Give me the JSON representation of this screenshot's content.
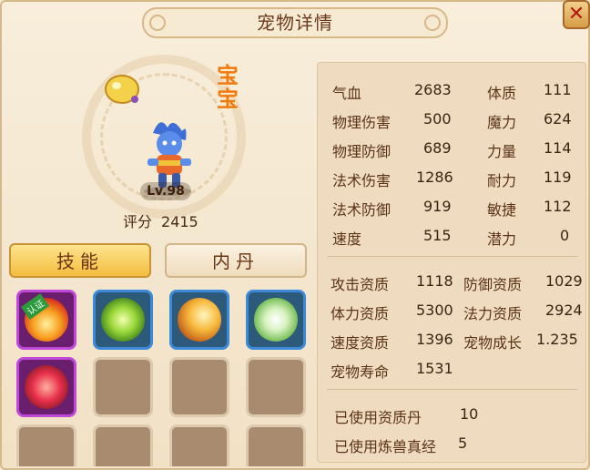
{
  "window": {
    "title": "宠物详情",
    "close_label": "✕"
  },
  "pet": {
    "tag": "宝宝",
    "level": "Lv.98",
    "score_label": "评分",
    "score_value": "2415"
  },
  "tabs": [
    {
      "label": "技能"
    },
    {
      "label": "内丹"
    }
  ],
  "skills": {
    "certified_badge": "认证"
  },
  "attributes": [
    {
      "label": "气血",
      "value": "2683"
    },
    {
      "label": "物理伤害",
      "value": "500"
    },
    {
      "label": "物理防御",
      "value": "689"
    },
    {
      "label": "法术伤害",
      "value": "1286"
    },
    {
      "label": "法术防御",
      "value": "919"
    },
    {
      "label": "速度",
      "value": "515"
    }
  ],
  "base_stats": [
    {
      "label": "体质",
      "value": "111"
    },
    {
      "label": "魔力",
      "value": "624"
    },
    {
      "label": "力量",
      "value": "114"
    },
    {
      "label": "耐力",
      "value": "119"
    },
    {
      "label": "敏捷",
      "value": "112"
    },
    {
      "label": "潜力",
      "value": "0"
    }
  ],
  "aptitudes": [
    {
      "label": "攻击资质",
      "value": "1118"
    },
    {
      "label": "防御资质",
      "value": "1029"
    },
    {
      "label": "体力资质",
      "value": "5300"
    },
    {
      "label": "法力资质",
      "value": "2924"
    },
    {
      "label": "速度资质",
      "value": "1396"
    },
    {
      "label": "宠物成长",
      "value": "1.235"
    },
    {
      "label": "宠物寿命",
      "value": "1531"
    }
  ],
  "usage": [
    {
      "label": "已使用资质丹",
      "value": "10"
    },
    {
      "label": "已使用炼兽真经",
      "value": "5"
    }
  ]
}
